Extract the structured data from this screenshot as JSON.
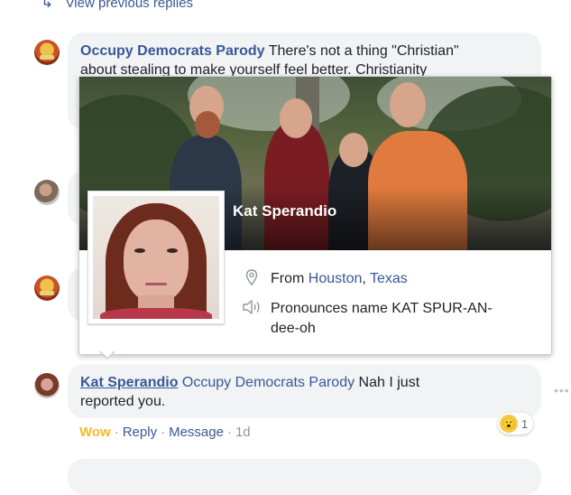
{
  "thread": {
    "view_previous_label": "View previous replies"
  },
  "comments": [
    {
      "author": "Occupy Democrats Parody",
      "text_line1": " There's not a thing \"Christian\"",
      "text_line2": "about stealing to make yourself feel better. Christianity"
    },
    {
      "author": "Kat Sperandio",
      "mention": "Occupy Democrats Parody",
      "text_line1": " Nah I just",
      "text_line2": "reported you."
    }
  ],
  "hover_card": {
    "name": "Kat Sperandio",
    "from_prefix": "From ",
    "city": "Houston",
    "separator": ", ",
    "state": "Texas",
    "pronounce_line1": "Pronounces name KAT SPUR-AN-",
    "pronounce_line2": "dee-oh",
    "icons": [
      "location-pin-icon",
      "speaker-icon"
    ]
  },
  "actions": {
    "wow": "Wow",
    "dot": "·",
    "reply": "Reply",
    "message": "Message",
    "time": "1d"
  },
  "reactions": {
    "emoji": "wow-emoji-icon",
    "count": "1"
  },
  "colors": {
    "link": "#385898",
    "wow": "#f7b928",
    "bubble": "#f2f3f5"
  }
}
